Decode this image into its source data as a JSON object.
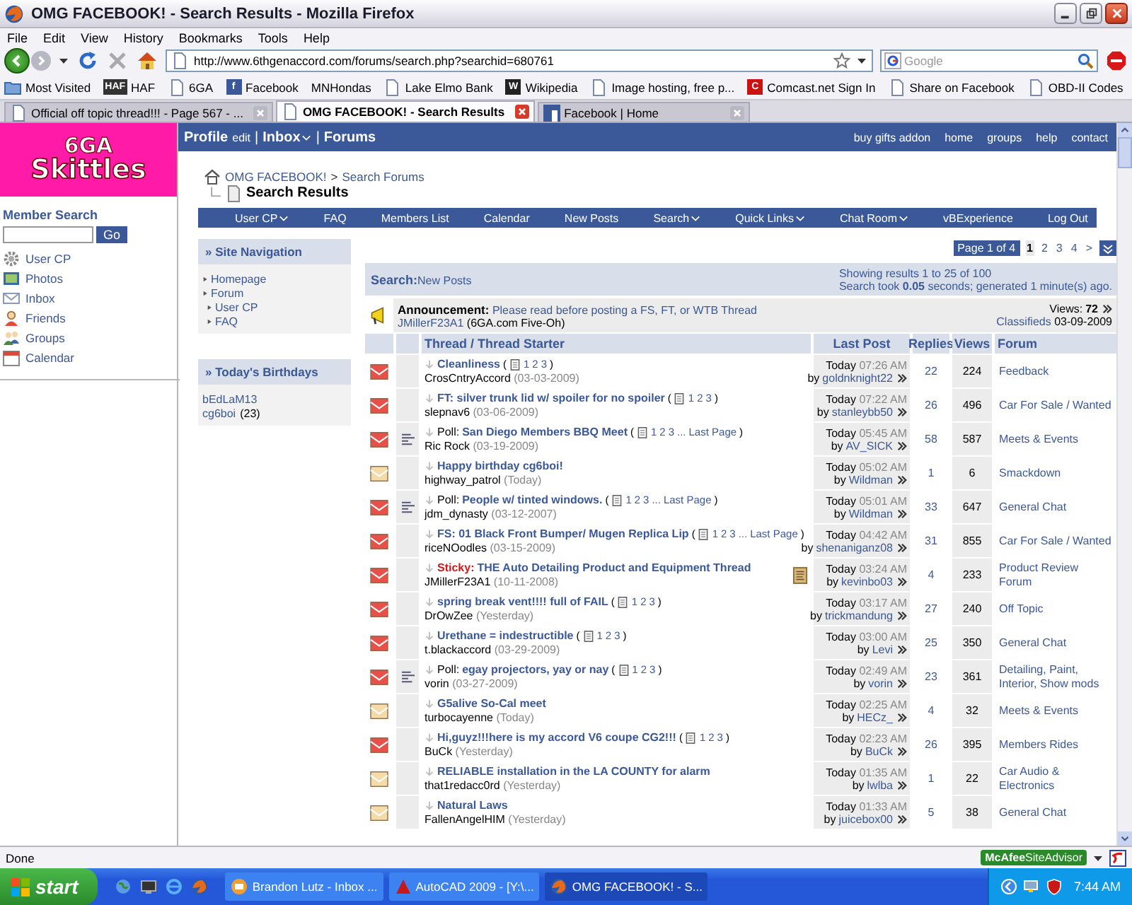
{
  "window": {
    "title": "OMG FACEBOOK! - Search Results - Mozilla Firefox"
  },
  "menu": [
    "File",
    "Edit",
    "View",
    "History",
    "Bookmarks",
    "Tools",
    "Help"
  ],
  "address": {
    "url": "http://www.6thgenaccord.com/forums/search.php?searchid=680761"
  },
  "search_box": {
    "placeholder": "Google"
  },
  "bookmarks": [
    {
      "label": "Most Visited",
      "kind": "folder"
    },
    {
      "label": "HAF",
      "kind": "letter",
      "icon_text": "HAF",
      "color": "#333333"
    },
    {
      "label": "6GA",
      "kind": "page"
    },
    {
      "label": "Facebook",
      "kind": "letter",
      "icon_text": "f",
      "color": "#3b5998"
    },
    {
      "label": "MNHondas",
      "kind": "none"
    },
    {
      "label": "Lake Elmo Bank",
      "kind": "page"
    },
    {
      "label": "Wikipedia",
      "kind": "letter",
      "icon_text": "W",
      "color": "#222222"
    },
    {
      "label": "Image hosting, free p...",
      "kind": "page"
    },
    {
      "label": "Comcast.net Sign In",
      "kind": "letter",
      "icon_text": "C",
      "color": "#cc1111"
    },
    {
      "label": "Share on Facebook",
      "kind": "page"
    },
    {
      "label": "OBD-II Codes",
      "kind": "page"
    }
  ],
  "tabs": [
    {
      "label": "Official off topic thread!!! - Page 567 - ...",
      "kind": "page",
      "selected": false
    },
    {
      "label": "OMG FACEBOOK! - Search Results",
      "kind": "page",
      "selected": true
    },
    {
      "label": "Facebook | Home",
      "kind": "facebook",
      "selected": false
    }
  ],
  "logo": {
    "line1": "6GA",
    "line2": "Skittles"
  },
  "member_search": {
    "title": "Member Search",
    "button": "Go"
  },
  "left_links": [
    {
      "label": "User CP",
      "kind": "gear"
    },
    {
      "label": "Photos",
      "kind": "photo"
    },
    {
      "label": "Inbox",
      "kind": "mail"
    },
    {
      "label": "Friends",
      "kind": "person"
    },
    {
      "label": "Groups",
      "kind": "people"
    },
    {
      "label": "Calendar",
      "kind": "calendar"
    }
  ],
  "topbar_left": [
    {
      "text": "Profile",
      "kind": "strong",
      "menu": false
    },
    {
      "text": "edit",
      "kind": "small",
      "menu": false
    },
    {
      "text": "|",
      "kind": "sep"
    },
    {
      "text": "Inbox",
      "kind": "strong",
      "menu": true
    },
    {
      "text": "|",
      "kind": "sep"
    },
    {
      "text": "Forums",
      "kind": "strong",
      "menu": false
    }
  ],
  "topbar_right": [
    "buy gifts addon",
    "home",
    "groups",
    "help",
    "contact"
  ],
  "breadcrumb": {
    "root": "OMG FACEBOOK!",
    "separator": ">",
    "parent": "Search Forums",
    "current": "Search Results"
  },
  "navbar": [
    {
      "label": "User CP",
      "menu": true
    },
    {
      "label": "FAQ",
      "menu": false
    },
    {
      "label": "Members List",
      "menu": false
    },
    {
      "label": "Calendar",
      "menu": false
    },
    {
      "label": "New Posts",
      "menu": false
    },
    {
      "label": "Search",
      "menu": true
    },
    {
      "label": "Quick Links",
      "menu": true
    },
    {
      "label": "Chat Room",
      "menu": true
    },
    {
      "label": "vBExperience",
      "menu": false
    },
    {
      "label": "Log Out",
      "menu": false
    }
  ],
  "site_navigation": {
    "title": "» Site Navigation",
    "items": [
      {
        "label": "Homepage"
      },
      {
        "label": "Forum",
        "children": [
          {
            "label": "User CP"
          },
          {
            "label": "FAQ"
          }
        ]
      }
    ]
  },
  "birthdays": {
    "title": "» Today's Birthdays",
    "people": [
      {
        "name": "bEdLaM13"
      },
      {
        "name": "cg6boi",
        "age": "(23)"
      }
    ]
  },
  "pager": {
    "label": "Page 1 of 4",
    "pages": [
      {
        "label": "1",
        "selected": true
      },
      {
        "label": "2",
        "selected": false
      },
      {
        "label": "3",
        "selected": false
      },
      {
        "label": "4",
        "selected": false
      }
    ],
    "next": ">"
  },
  "search_header": {
    "label": "Search:",
    "query": "New Posts",
    "showing": "Showing results 1 to 25 of 100",
    "timing": "Search took **0.05** seconds; generated 1 minute(s) ago."
  },
  "announcement": {
    "label": "Announcement:",
    "title": "Please read before posting a FS, FT, or WTB Thread",
    "author": "JMillerF23A1",
    "author_title": "(6GA.com Five-Oh)",
    "views_label": "Views:",
    "views": "72",
    "forum": "Classifieds",
    "date": "03-09-2009"
  },
  "columns": [
    "Thread / Thread Starter",
    "Last Post",
    "Replies",
    "Views",
    "Forum"
  ],
  "threads": [
    {
      "kind": "normal",
      "hot": true,
      "title": "Cleanliness",
      "pages": {
        "open": "(",
        "links": [
          "1",
          "2",
          "3"
        ],
        "close": ")"
      },
      "starter": "CrosCntryAccord",
      "started": "(03-03-2009)",
      "date": "Today",
      "time": "07:26 AM",
      "by": "by",
      "last_poster": "goldnknight22",
      "replies": "22",
      "views": "224",
      "forum": "Feedback"
    },
    {
      "kind": "normal",
      "hot": true,
      "title": "FT: silver trunk lid w/ spoiler for no spoiler",
      "pages": {
        "open": "(",
        "links": [
          "1",
          "2",
          "3"
        ],
        "close": ")"
      },
      "starter": "slepnav6",
      "started": "(03-06-2009)",
      "date": "Today",
      "time": "07:22 AM",
      "by": "by",
      "last_poster": "stanleybb50",
      "replies": "26",
      "views": "496",
      "forum": "Car For Sale / Wanted"
    },
    {
      "kind": "poll",
      "prefix": "Poll:",
      "hot": true,
      "title": "San Diego Members BBQ Meet",
      "pages": {
        "open": "(",
        "links": [
          "1",
          "2",
          "3",
          "...",
          "Last Page"
        ],
        "close": ")"
      },
      "starter": "Ric Rock",
      "started": "(03-19-2009)",
      "date": "Today",
      "time": "05:45 AM",
      "by": "by",
      "last_poster": "AV_SICK",
      "replies": "58",
      "views": "587",
      "forum": "Meets & Events"
    },
    {
      "kind": "normal",
      "hot": false,
      "title": "Happy birthday cg6boi!",
      "starter": "highway_patrol",
      "started": "(Today)",
      "date": "Today",
      "time": "05:02 AM",
      "by": "by",
      "last_poster": "Wildman",
      "replies": "1",
      "views": "6",
      "forum": "Smackdown"
    },
    {
      "kind": "poll",
      "prefix": "Poll:",
      "hot": true,
      "title": "People w/ tinted windows.",
      "pages": {
        "open": "(",
        "links": [
          "1",
          "2",
          "3",
          "...",
          "Last Page"
        ],
        "close": ")"
      },
      "starter": "jdm_dynasty",
      "started": "(03-12-2007)",
      "date": "Today",
      "time": "05:01 AM",
      "by": "by",
      "last_poster": "Wildman",
      "replies": "33",
      "views": "647",
      "forum": "General Chat"
    },
    {
      "kind": "normal",
      "hot": true,
      "title": "FS: 01 Black Front Bumper/ Mugen Replica Lip",
      "pages": {
        "open": "(",
        "links": [
          "1",
          "2",
          "3",
          "...",
          "Last Page"
        ],
        "close": ")"
      },
      "starter": "riceNOodles",
      "started": "(03-15-2009)",
      "date": "Today",
      "time": "04:42 AM",
      "by": "by",
      "last_poster": "shenaniganz08",
      "replies": "31",
      "views": "855",
      "forum": "Car For Sale / Wanted"
    },
    {
      "kind": "sticky",
      "prefix": "Sticky:",
      "hot": true,
      "attachment": true,
      "title": "THE Auto Detailing Product and Equipment Thread",
      "starter": "JMillerF23A1",
      "started": "(10-11-2008)",
      "date": "Today",
      "time": "03:24 AM",
      "by": "by",
      "last_poster": "kevinbo03",
      "replies": "4",
      "views": "233",
      "forum": "Product Review Forum"
    },
    {
      "kind": "normal",
      "hot": true,
      "title": "spring break vent!!!! full of FAIL",
      "pages": {
        "open": "(",
        "links": [
          "1",
          "2",
          "3"
        ],
        "close": ")"
      },
      "starter": "DrOwZee",
      "started": "(Yesterday)",
      "date": "Today",
      "time": "03:17 AM",
      "by": "by",
      "last_poster": "trickmandung",
      "replies": "27",
      "views": "240",
      "forum": "Off Topic"
    },
    {
      "kind": "normal",
      "hot": true,
      "title": "Urethane = indestructible",
      "pages": {
        "open": "(",
        "links": [
          "1",
          "2",
          "3"
        ],
        "close": ")"
      },
      "starter": "t.blackaccord",
      "started": "(03-29-2009)",
      "date": "Today",
      "time": "03:00 AM",
      "by": "by",
      "last_poster": "Levi",
      "replies": "25",
      "views": "350",
      "forum": "General Chat"
    },
    {
      "kind": "poll",
      "prefix": "Poll:",
      "hot": true,
      "title": "egay projectors, yay or nay",
      "pages": {
        "open": "(",
        "links": [
          "1",
          "2",
          "3"
        ],
        "close": ")"
      },
      "starter": "vorin",
      "started": "(03-27-2009)",
      "date": "Today",
      "time": "02:49 AM",
      "by": "by",
      "last_poster": "vorin",
      "replies": "23",
      "views": "361",
      "forum": "Detailing, Paint, Interior, Show mods"
    },
    {
      "kind": "normal",
      "hot": false,
      "title": "G5alive So-Cal meet",
      "starter": "turbocayenne",
      "started": "(Today)",
      "date": "Today",
      "time": "02:25 AM",
      "by": "by",
      "last_poster": "HECz_",
      "replies": "4",
      "views": "32",
      "forum": "Meets & Events"
    },
    {
      "kind": "normal",
      "hot": true,
      "title": "Hi,guyz!!!here is my accord V6 coupe CG2!!!",
      "pages": {
        "open": "(",
        "links": [
          "1",
          "2",
          "3"
        ],
        "close": ")"
      },
      "starter": "BuCk",
      "started": "(Yesterday)",
      "date": "Today",
      "time": "02:23 AM",
      "by": "by",
      "last_poster": "BuCk",
      "replies": "26",
      "views": "395",
      "forum": "Members Rides"
    },
    {
      "kind": "normal",
      "hot": false,
      "title": "RELIABLE installation in the LA COUNTY for alarm",
      "starter": "that1redacc0rd",
      "started": "(Yesterday)",
      "date": "Today",
      "time": "01:35 AM",
      "by": "by",
      "last_poster": "lwlba",
      "replies": "1",
      "views": "22",
      "forum": "Car Audio & Electronics"
    },
    {
      "kind": "normal",
      "hot": false,
      "title": "Natural Laws",
      "starter": "FallenAngelHIM",
      "started": "(Yesterday)",
      "date": "Today",
      "time": "01:33 AM",
      "by": "by",
      "last_poster": "juicebox00",
      "replies": "5",
      "views": "38",
      "forum": "General Chat"
    }
  ],
  "status_bar": {
    "text": "Done",
    "brand": "McAfee",
    "product": "SiteAdvisor"
  },
  "taskbar": {
    "start": "start",
    "tasks": [
      {
        "label": "Brandon Lutz - Inbox ...",
        "kind": "mail",
        "selected": false
      },
      {
        "label": "AutoCAD 2009 - [Y:\\...",
        "kind": "autocad",
        "selected": false
      },
      {
        "label": "OMG FACEBOOK! - S...",
        "kind": "firefox",
        "selected": true
      }
    ],
    "clock": "7:44 AM"
  }
}
